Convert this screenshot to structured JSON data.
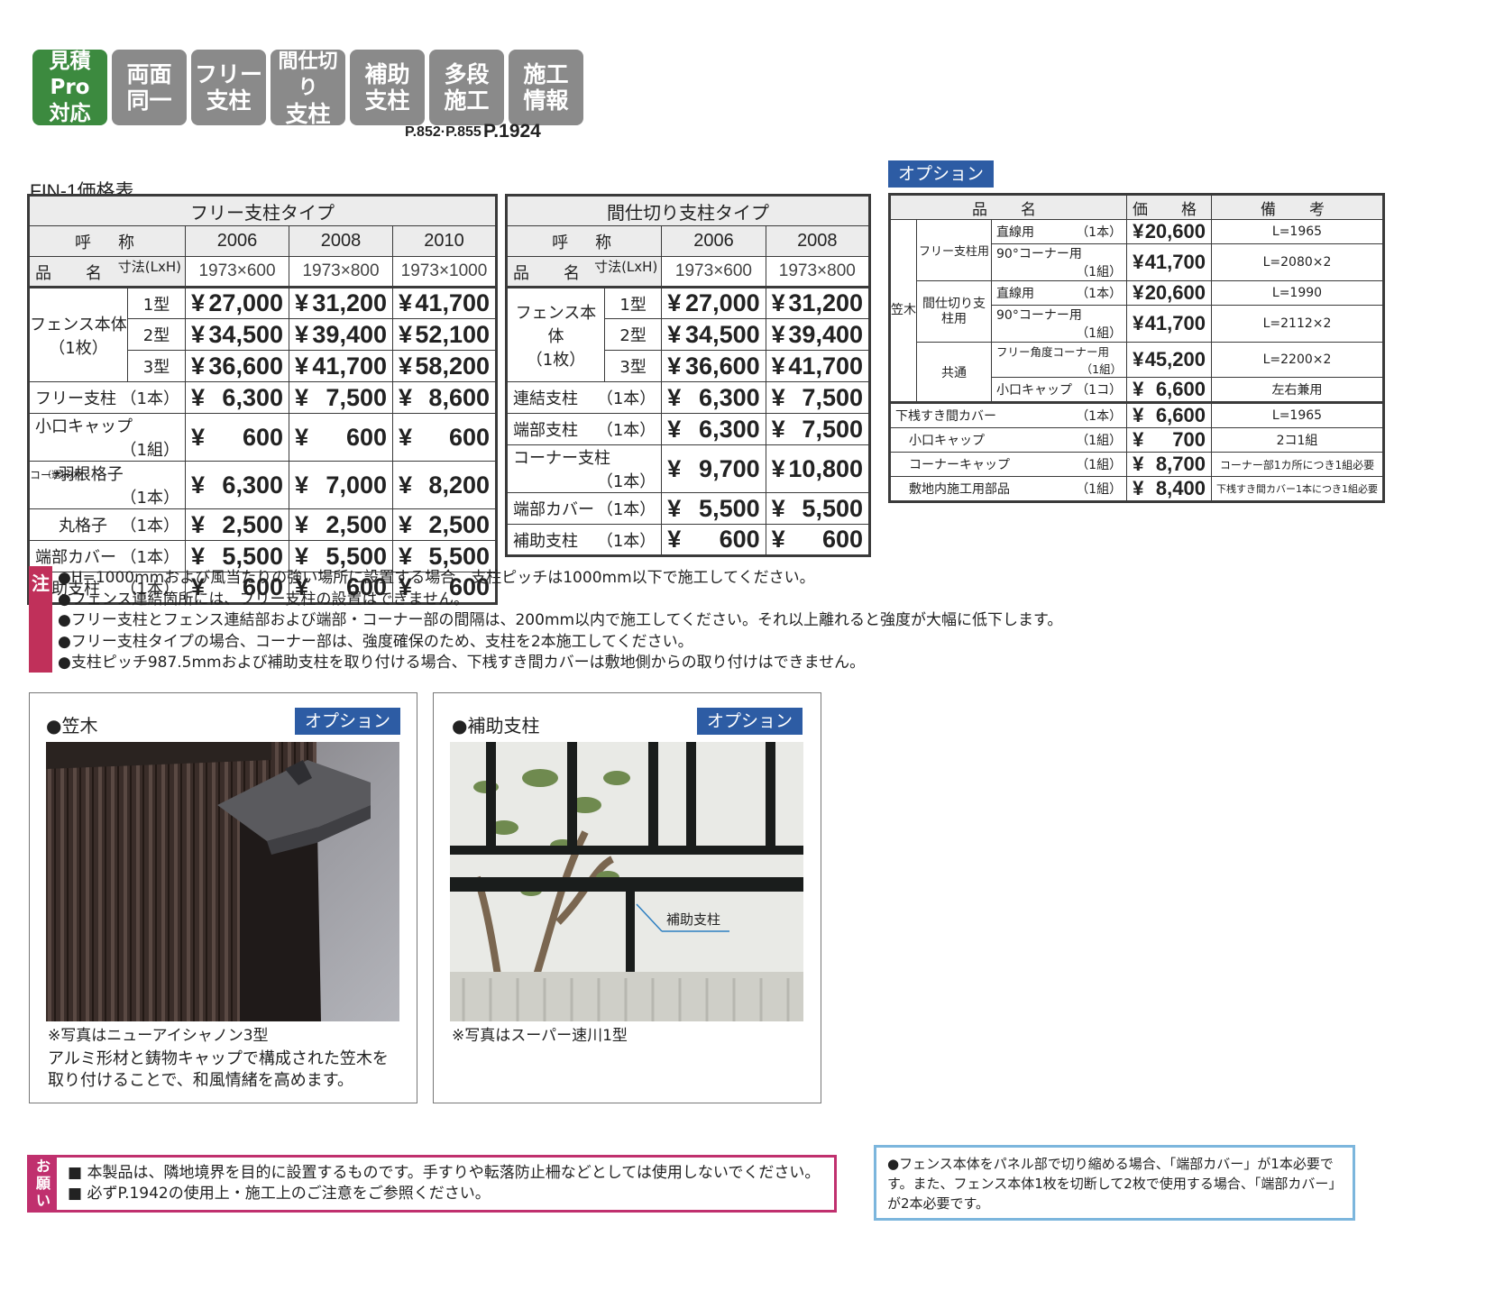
{
  "badges": [
    {
      "l1": "見積Pro",
      "l2": "対応",
      "color": "#3c8a3f"
    },
    {
      "l1": "両面",
      "l2": "同一",
      "color": "#8a8a8a"
    },
    {
      "l1": "フリー",
      "l2": "支柱",
      "color": "#8a8a8a"
    },
    {
      "l1": "間仕切り",
      "l2": "支柱",
      "color": "#8a8a8a"
    },
    {
      "l1": "補助",
      "l2": "支柱",
      "color": "#8a8a8a"
    },
    {
      "l1": "多段",
      "l2": "施工",
      "color": "#8a8a8a"
    },
    {
      "l1": "施工",
      "l2": "情報",
      "color": "#8a8a8a"
    }
  ],
  "page_refs": {
    "a": "P.852·P.855",
    "b": "P.1924"
  },
  "doc_title": "FIN-1価格表",
  "free_table": {
    "title": "フリー支柱タイプ",
    "col_label": "呼　称",
    "dim_label": "寸法(LxH)",
    "item_label": "品　名",
    "years": [
      "2006",
      "2008",
      "2010"
    ],
    "dims": [
      "1973×600",
      "1973×800",
      "1973×1000"
    ],
    "body_label1": "フェンス本体",
    "body_label2": "（1枚）",
    "yen": "¥",
    "types": [
      {
        "type": "1型",
        "prices": [
          "27,000",
          "31,200",
          "41,700"
        ]
      },
      {
        "type": "2型",
        "prices": [
          "34,500",
          "39,400",
          "52,100"
        ]
      },
      {
        "type": "3型",
        "prices": [
          "36,600",
          "41,700",
          "58,200"
        ]
      }
    ],
    "rows_a": [
      {
        "name": "フリー支柱",
        "cnt": "（1本）",
        "prices": [
          "6,300",
          "7,500",
          "8,600"
        ]
      },
      {
        "name": "小口キャップ",
        "cnt": "（1組）",
        "prices": [
          "600",
          "600",
          "600"
        ]
      }
    ],
    "corner_group": "コーナー材",
    "corner_sel": "（選択）",
    "corner_rows": [
      {
        "name": "羽根格子",
        "cnt": "（1本）",
        "prices": [
          "6,300",
          "7,000",
          "8,200"
        ]
      },
      {
        "name": "丸格子",
        "cnt": "（1本）",
        "prices": [
          "2,500",
          "2,500",
          "2,500"
        ]
      }
    ],
    "rows_b": [
      {
        "name": "端部カバー",
        "cnt": "（1本）",
        "prices": [
          "5,500",
          "5,500",
          "5,500"
        ]
      },
      {
        "name": "補助支柱",
        "cnt": "（1本）",
        "prices": [
          "600",
          "600",
          "600"
        ]
      }
    ]
  },
  "partition_table": {
    "title": "間仕切り支柱タイプ",
    "years": [
      "2006",
      "2008"
    ],
    "dims": [
      "1973×600",
      "1973×800"
    ],
    "types": [
      {
        "type": "1型",
        "prices": [
          "27,000",
          "31,200"
        ]
      },
      {
        "type": "2型",
        "prices": [
          "34,500",
          "39,400"
        ]
      },
      {
        "type": "3型",
        "prices": [
          "36,600",
          "41,700"
        ]
      }
    ],
    "rows": [
      {
        "name": "連結支柱",
        "cnt": "（1本）",
        "prices": [
          "6,300",
          "7,500"
        ]
      },
      {
        "name": "端部支柱",
        "cnt": "（1本）",
        "prices": [
          "6,300",
          "7,500"
        ]
      },
      {
        "name": "コーナー支柱",
        "cnt": "（1本）",
        "prices": [
          "9,700",
          "10,800"
        ]
      },
      {
        "name": "端部カバー",
        "cnt": "（1本）",
        "prices": [
          "5,500",
          "5,500"
        ]
      },
      {
        "name": "補助支柱",
        "cnt": "（1本）",
        "prices": [
          "600",
          "600"
        ]
      }
    ]
  },
  "option": {
    "label": "オプション",
    "headers": [
      "品　名",
      "価　格",
      "備　考"
    ],
    "kasagi": "笠木",
    "groups": [
      {
        "group": "フリー支柱用",
        "rows": [
          {
            "name": "直線用",
            "cnt": "（1本）",
            "price": "20,600",
            "remark": "L=1965"
          },
          {
            "name": "90°コーナー用",
            "cnt": "（1組）",
            "price": "41,700",
            "remark": "L=2080×2"
          }
        ]
      },
      {
        "group": "間仕切り支柱用",
        "rows": [
          {
            "name": "直線用",
            "cnt": "（1本）",
            "price": "20,600",
            "remark": "L=1990"
          },
          {
            "name": "90°コーナー用",
            "cnt": "（1組）",
            "price": "41,700",
            "remark": "L=2112×2"
          }
        ]
      },
      {
        "group": "共通",
        "rows": [
          {
            "name": "フリー角度コーナー用",
            "cnt": "（1組）",
            "price": "45,200",
            "remark": "L=2200×2"
          },
          {
            "name": "小口キャップ",
            "cnt": "（1コ）",
            "price": "6,600",
            "remark": "左右兼用"
          }
        ]
      }
    ],
    "shitazan": {
      "name": "下桟すき間カバー",
      "cnt": "（1本）",
      "price": "6,600",
      "remark": "L=1965"
    },
    "sub_rows": [
      {
        "name": "小口キャップ",
        "cnt": "（1組）",
        "price": "700",
        "remark": "2コ1組"
      },
      {
        "name": "コーナーキャップ",
        "cnt": "（1組）",
        "price": "8,700",
        "remark": "コーナー部1カ所につき1組必要"
      },
      {
        "name": "敷地内施工用部品",
        "cnt": "（1組）",
        "price": "8,400",
        "remark": "下桟すき間カバー1本につき1組必要"
      }
    ]
  },
  "notes_tag": "注",
  "notes": [
    "●H=1000mmおよび風当たりの強い場所に設置する場合、支柱ピッチは1000mm以下で施工してください。",
    "●フェンス連結箇所には、フリー支柱の設置はできません。",
    "●フリー支柱とフェンス連結部および端部・コーナー部の間隔は、200mm以内で施工してください。それ以上離れると強度が大幅に低下します。",
    "●フリー支柱タイプの場合、コーナー部は、強度確保のため、支柱を2本施工してください。",
    "●支柱ピッチ987.5mmおよび補助支柱を取り付ける場合、下桟すき間カバーは敷地側からの取り付けはできません。"
  ],
  "panel_kasagi": {
    "title": "●笠木",
    "opt": "オプション",
    "caption1": "※写真はニューアイシャノン3型",
    "caption2": "アルミ形材と鋳物キャップで構成された笠木を",
    "caption3": "取り付けることで、和風情緒を高めます。"
  },
  "panel_hojo": {
    "title": "●補助支柱",
    "opt": "オプション",
    "callout": "補助支柱",
    "caption1": "※写真はスーパー速川1型"
  },
  "request": {
    "tag": [
      "お",
      "願",
      "い"
    ],
    "lines": [
      "■ 本製品は、隣地境界を目的に設置するものです。手すりや転落防止柵などとしては使用しないでください。",
      "■ 必ずP.1942の使用上・施工上のご注意をご参照ください。"
    ]
  },
  "info": "●フェンス本体をパネル部で切り縮める場合、「端部カバー」が1本必要です。また、フェンス本体1枚を切断して2枚で使用する場合、「端部カバー」が2本必要です。",
  "colors": {
    "accent_blue": "#2d5ca4",
    "note_red": "#c0305a",
    "request_pink": "#c0306e",
    "info_blue": "#7cb6dd",
    "badge_green": "#3c8a3f",
    "badge_gray": "#8a8a8a"
  }
}
